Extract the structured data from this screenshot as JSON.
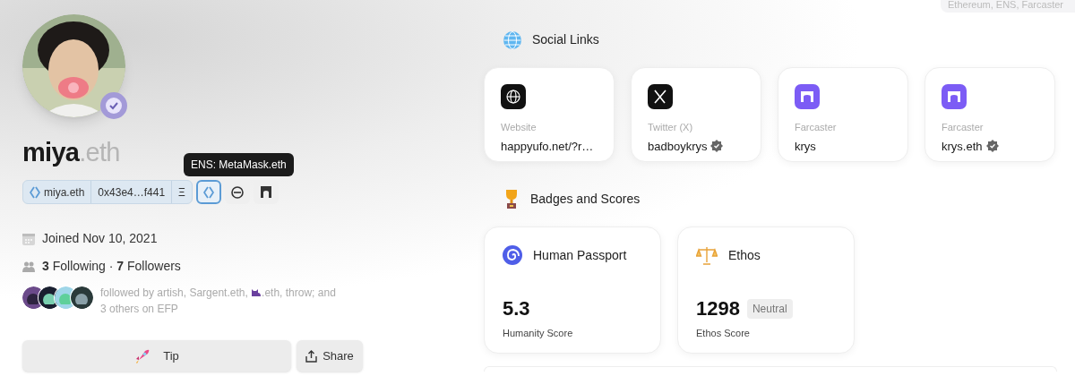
{
  "corner_note": "Ethereum, ENS, Farcaster",
  "profile": {
    "avatar": {
      "kind": "picture",
      "verified": true
    },
    "name": "miya",
    "suffix": ".eth",
    "address_chip": [
      {
        "kind": "ens",
        "text": "miya.eth"
      },
      {
        "kind": "address",
        "text": "0x43e4…f441"
      },
      {
        "kind": "eth",
        "text": "Ξ"
      }
    ],
    "icon_buttons": [
      {
        "kind": "ens",
        "selected": true
      },
      {
        "kind": "minus",
        "selected": false
      },
      {
        "kind": "farcaster",
        "selected": false
      }
    ],
    "tooltip": "ENS: MetaMask.eth",
    "joined": "Joined Nov 10, 2021",
    "follow_stats": "**3** Following · **7** Followers",
    "followed_by": {
      "before": "followed by artish, Sargent.eth, ",
      "after": ".eth, throw; and 3 others on EFP"
    },
    "buttons": [
      {
        "kind": "tip",
        "label": "Tip"
      },
      {
        "kind": "share",
        "label": "Share"
      }
    ]
  },
  "social_links": {
    "title": "Social Links",
    "links": [
      {
        "kind": "website",
        "platform": "Website",
        "handle": "happyufo.net/?r…",
        "verified": false
      },
      {
        "kind": "x",
        "platform": "Twitter (X)",
        "handle": "badboykrys",
        "verified": true
      },
      {
        "kind": "farcaster",
        "platform": "Farcaster",
        "handle": "krys",
        "verified": false
      },
      {
        "kind": "farcaster",
        "platform": "Farcaster",
        "handle": "krys.eth",
        "verified": true
      }
    ]
  },
  "badges": {
    "title": "Badges and Scores",
    "cards": [
      {
        "kind": "passport",
        "title": "Human Passport",
        "score": "5.3",
        "label": "Humanity Score"
      },
      {
        "kind": "ethos",
        "title": "Ethos",
        "score": "1298",
        "tag": "Neutral",
        "label": "Ethos Score"
      }
    ]
  }
}
